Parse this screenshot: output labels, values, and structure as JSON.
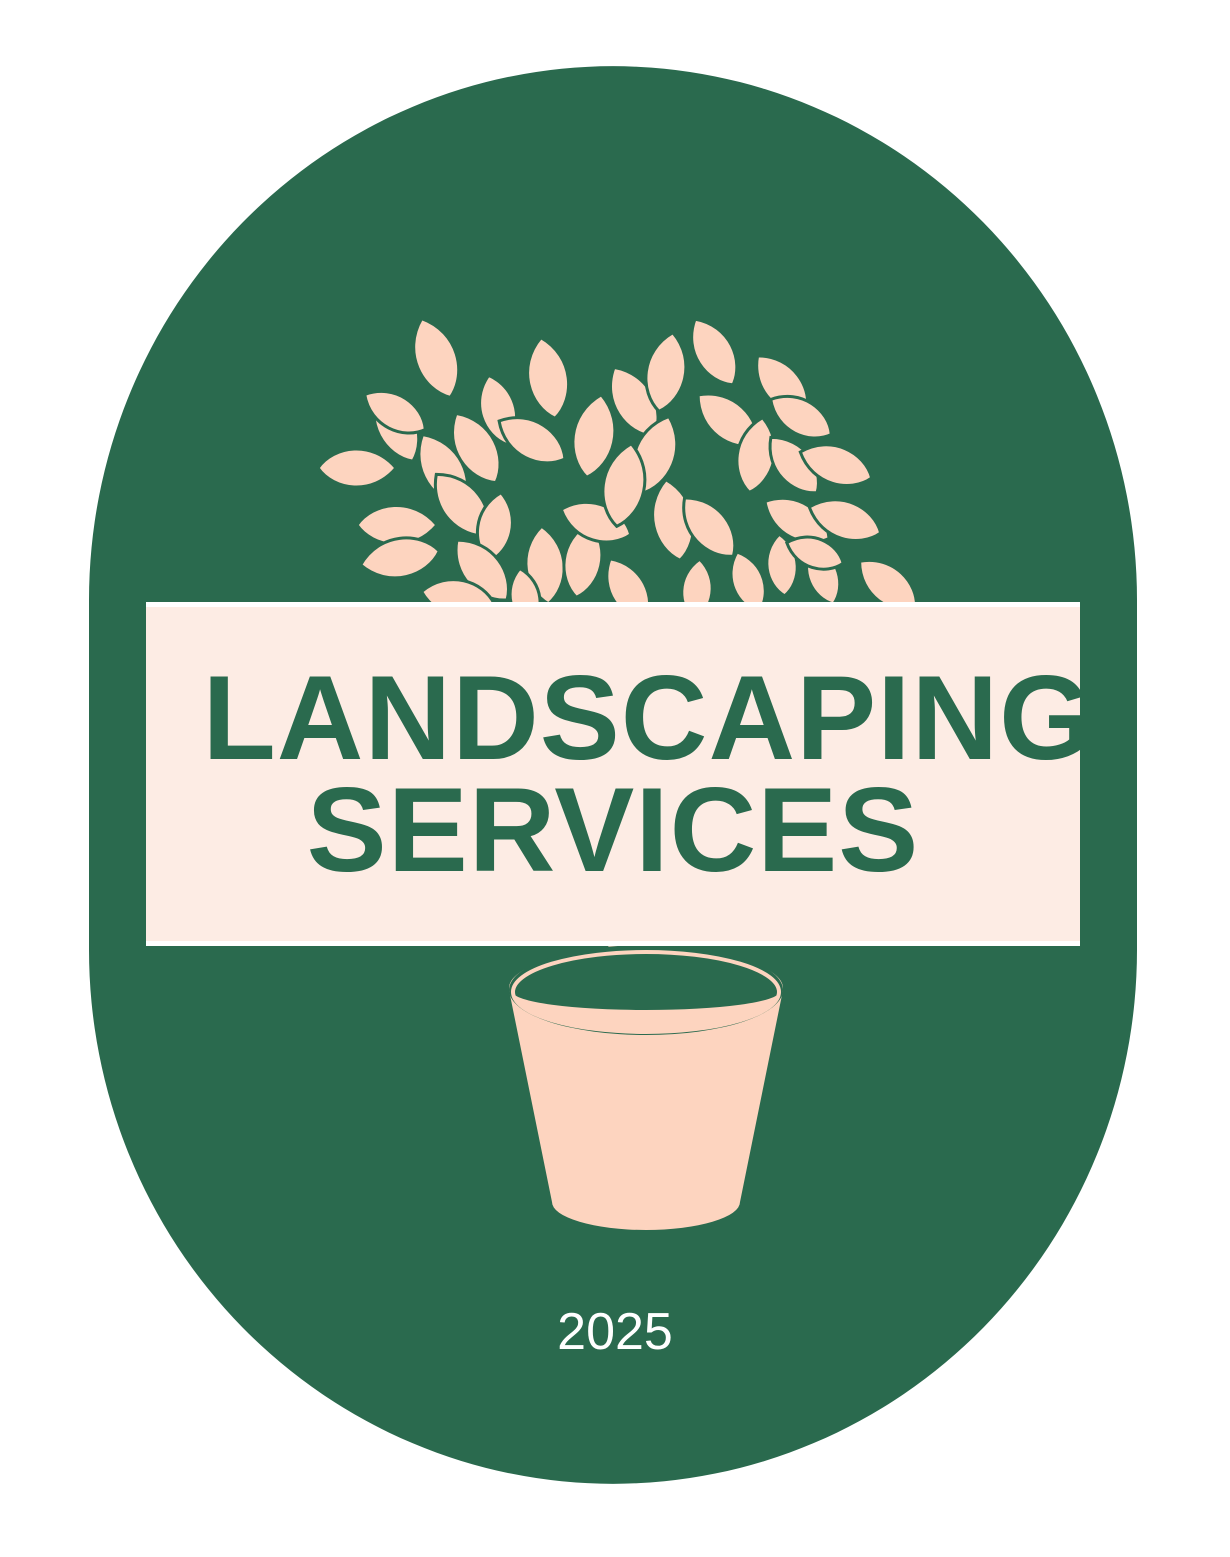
{
  "colors": {
    "badge_green": "#2a6a4e",
    "leaf_peach": "#fdd4bf",
    "banner_cream": "#fdece4",
    "white": "#ffffff"
  },
  "icons": [
    "potted-tree-icon"
  ],
  "title": {
    "line1": "LANDSCAPING",
    "line2": "SERVICES"
  },
  "year": "2025"
}
